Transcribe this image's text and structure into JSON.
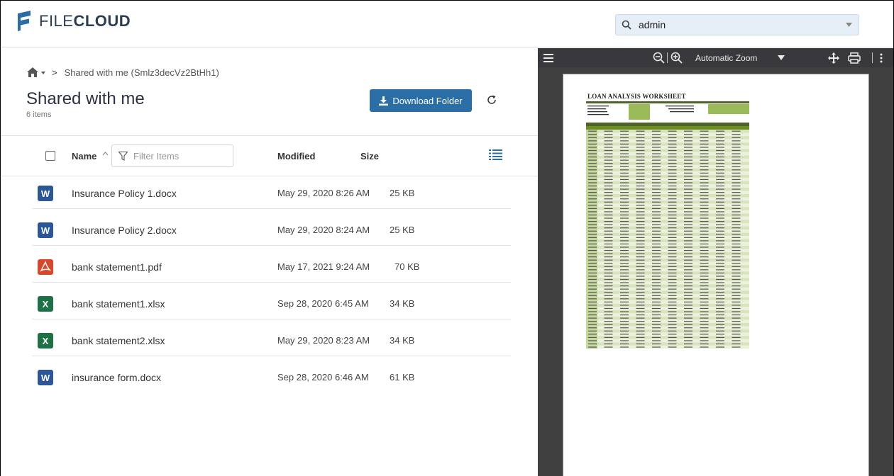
{
  "header": {
    "logo_text_light": "FILE",
    "logo_text_bold": "CLOUD",
    "user_search_value": "admin",
    "icons": {
      "search": "search-icon",
      "caret": "chevron-down-icon"
    }
  },
  "breadcrumb": {
    "home_icon": "home-icon",
    "separator": ">",
    "current": "Shared with me (Smlz3decVz2BtHh1)"
  },
  "folder": {
    "title": "Shared with me",
    "count": "6 items",
    "download_label": "Download Folder"
  },
  "list_header": {
    "name": "Name",
    "filter_placeholder": "Filter Items",
    "modified": "Modified",
    "size": "Size"
  },
  "files": [
    {
      "name": "Insurance Policy 1.docx",
      "modified": "May 29, 2020 8:26 AM",
      "size": "25 KB",
      "type": "word",
      "color": "#2b5797"
    },
    {
      "name": "Insurance Policy 2.docx",
      "modified": "May 29, 2020 8:24 AM",
      "size": "25 KB",
      "type": "word",
      "color": "#2b5797"
    },
    {
      "name": "bank statement1.pdf",
      "modified": "May 17, 2021 9:24 AM",
      "size": "70 KB",
      "type": "pdf",
      "color": "#d9472b"
    },
    {
      "name": "bank statement1.xlsx",
      "modified": "Sep 28, 2020 6:45 AM",
      "size": "34 KB",
      "type": "excel",
      "color": "#1e7145"
    },
    {
      "name": "bank statement2.xlsx",
      "modified": "May 29, 2020 8:23 AM",
      "size": "34 KB",
      "type": "excel",
      "color": "#1e7145"
    },
    {
      "name": "insurance form.docx",
      "modified": "Sep 28, 2020 6:46 AM",
      "size": "61 KB",
      "type": "word",
      "color": "#2b5797"
    }
  ],
  "viewer": {
    "zoom_label": "Automatic Zoom",
    "document_title": "LOAN ANALYSIS WORKSHEET"
  },
  "colors": {
    "brand_blue": "#2b6ea6",
    "viewer_bg": "#404040",
    "viewer_toolbar": "#38383d",
    "sheet_green": "#4f6228",
    "sheet_light": "#d8e4bc"
  }
}
